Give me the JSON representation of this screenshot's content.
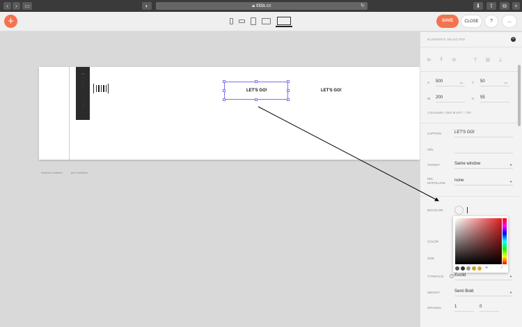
{
  "browser": {
    "url": "tilda.cc"
  },
  "toolbar": {
    "save_label": "SAVE",
    "close_label": "CLOSE",
    "help_label": "?",
    "more_label": "..."
  },
  "canvas": {
    "button_left_text": "LET'S GO!",
    "button_right_text": "LET'S GO!",
    "label_section": "window container",
    "label_grid": "grid container"
  },
  "panel": {
    "title": "ELEMENTS SELECTED",
    "x_label": "X",
    "x_value": "500",
    "x_unit": "px",
    "y_label": "Y",
    "y_value": "50",
    "y_unit": "px",
    "w_label": "W",
    "w_value": "200",
    "h_label": "H",
    "h_value": "55",
    "container_hint": "CONTAINER: GRID ⊞ LEFT ↑ TOP",
    "caption_label": "CAPTION",
    "caption_value": "LET'S GO!",
    "url_label": "URL",
    "url_value": "",
    "target_label": "TARGET",
    "target_value": "Same window",
    "rel_label": "REL NOFOLLOW",
    "rel_value": "none",
    "bgcolor_label": "BGCOLOR",
    "color_label": "COLOR",
    "size_label": "SIZE",
    "typeface_label": "TYPEFACE",
    "typeface_value": "Euclid",
    "weight_label": "WEIGHT",
    "weight_value": "Semi Bold",
    "spacing_label": "SPACING",
    "spacing_value_1": "1",
    "spacing_value_2": "0"
  },
  "colors": {
    "accent": "#f4734f",
    "selection": "#7c73e6",
    "swatches": [
      "#555555",
      "#333333",
      "#999999",
      "#c9a227",
      "#e0a83a"
    ]
  }
}
